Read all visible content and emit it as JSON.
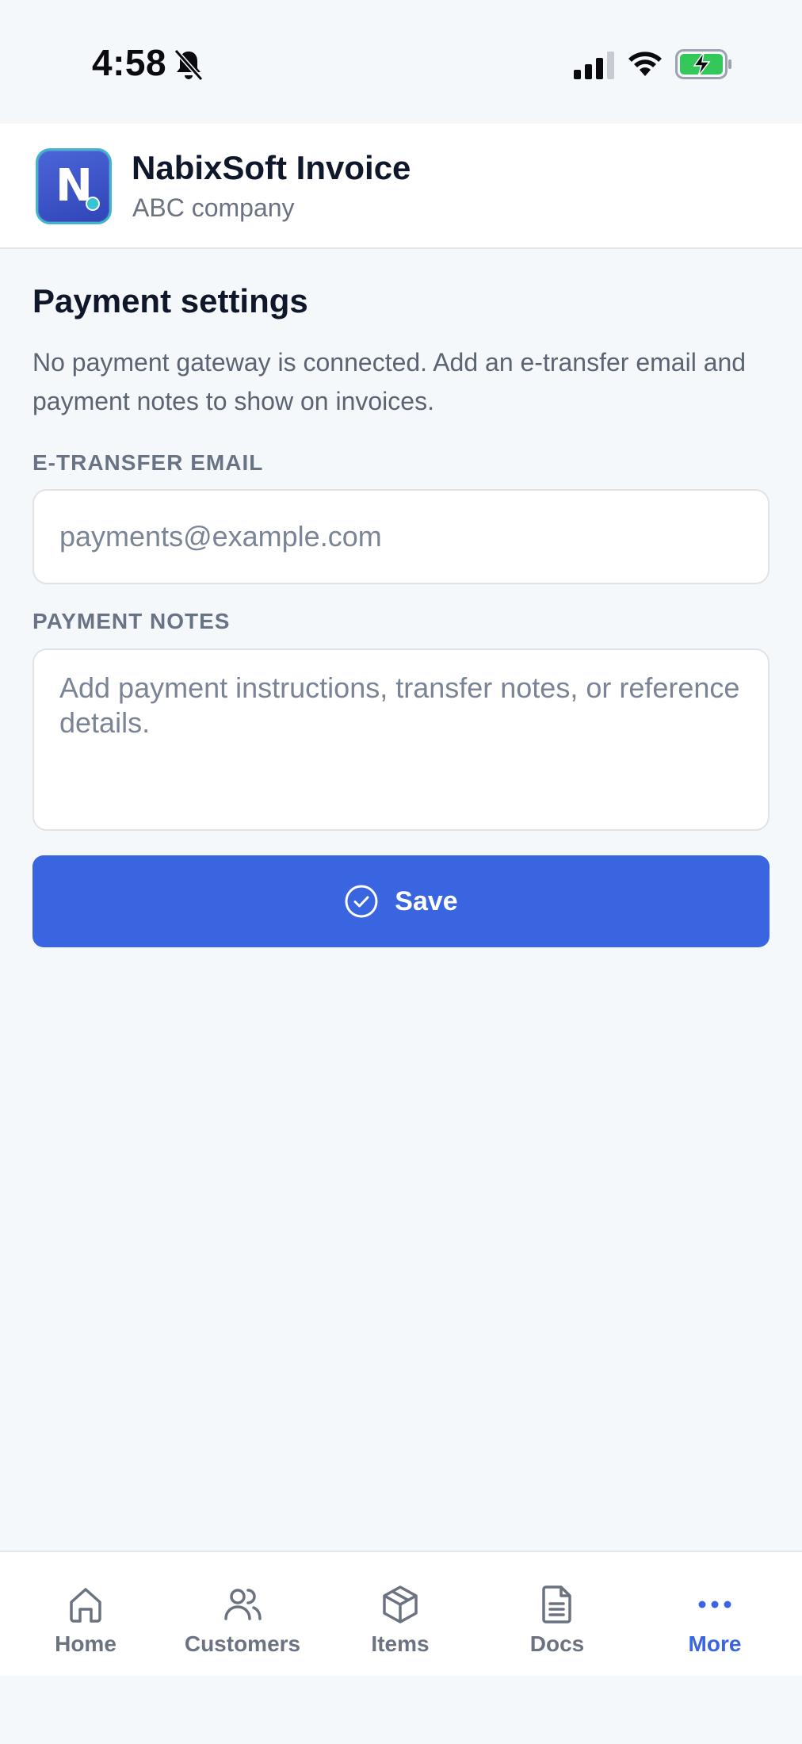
{
  "status_bar": {
    "time": "4:58"
  },
  "header": {
    "logo_letter": "N",
    "title": "NabixSoft Invoice",
    "subtitle": "ABC company"
  },
  "page": {
    "title": "Payment settings",
    "description": "No payment gateway is connected. Add an e-transfer email and payment notes to show on invoices."
  },
  "form": {
    "email_label": "E-TRANSFER EMAIL",
    "email_value": "",
    "email_placeholder": "payments@example.com",
    "notes_label": "PAYMENT NOTES",
    "notes_value": "",
    "notes_placeholder": "Add payment instructions, transfer notes, or reference details.",
    "save_label": "Save"
  },
  "tabs": [
    {
      "label": "Home",
      "icon": "home-icon",
      "active": false
    },
    {
      "label": "Customers",
      "icon": "users-icon",
      "active": false
    },
    {
      "label": "Items",
      "icon": "box-icon",
      "active": false
    },
    {
      "label": "Docs",
      "icon": "document-icon",
      "active": false
    },
    {
      "label": "More",
      "icon": "more-dots-icon",
      "active": true
    }
  ],
  "colors": {
    "accent": "#3a65e0",
    "background": "#f5f8fa",
    "inactive_tab": "#6b7280",
    "battery_fill": "#34c759"
  }
}
